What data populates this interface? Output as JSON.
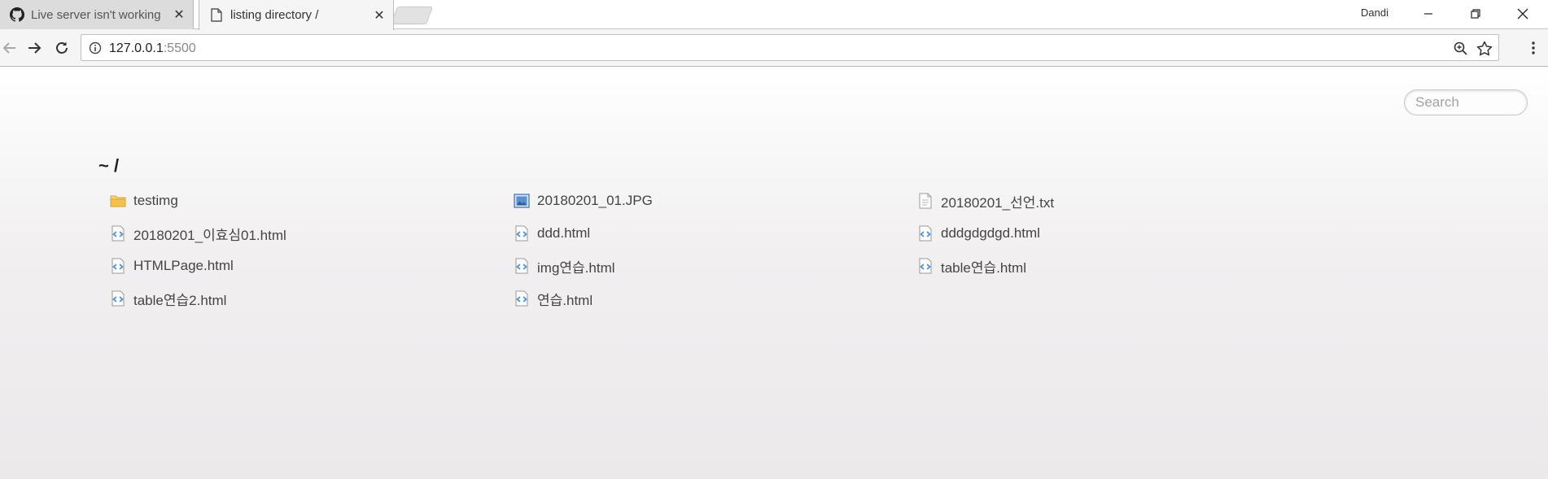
{
  "tabs": [
    {
      "title": "Live server isn't working",
      "icon": "github-icon",
      "active": false
    },
    {
      "title": "listing directory /",
      "icon": "page-icon",
      "active": true
    }
  ],
  "window": {
    "profile_name": "Dandi"
  },
  "toolbar": {
    "url_host": "127.0.0.1",
    "url_port": ":5500"
  },
  "page": {
    "search_placeholder": "Search",
    "breadcrumb": "~ /",
    "files": [
      {
        "name": "testimg",
        "type": "folder"
      },
      {
        "name": "20180201_01.JPG",
        "type": "image"
      },
      {
        "name": "20180201_선언.txt",
        "type": "text"
      },
      {
        "name": "20180201_이효심01.html",
        "type": "code"
      },
      {
        "name": "ddd.html",
        "type": "code"
      },
      {
        "name": "dddgdgdgd.html",
        "type": "code"
      },
      {
        "name": "HTMLPage.html",
        "type": "code"
      },
      {
        "name": "img연습.html",
        "type": "code"
      },
      {
        "name": "table연습.html",
        "type": "code"
      },
      {
        "name": "table연습2.html",
        "type": "code"
      },
      {
        "name": "연습.html",
        "type": "code"
      }
    ]
  },
  "colors": {
    "folder": "#f2c14e",
    "code_icon": "#4a90d9",
    "image_icon": "#3d6fb0"
  }
}
